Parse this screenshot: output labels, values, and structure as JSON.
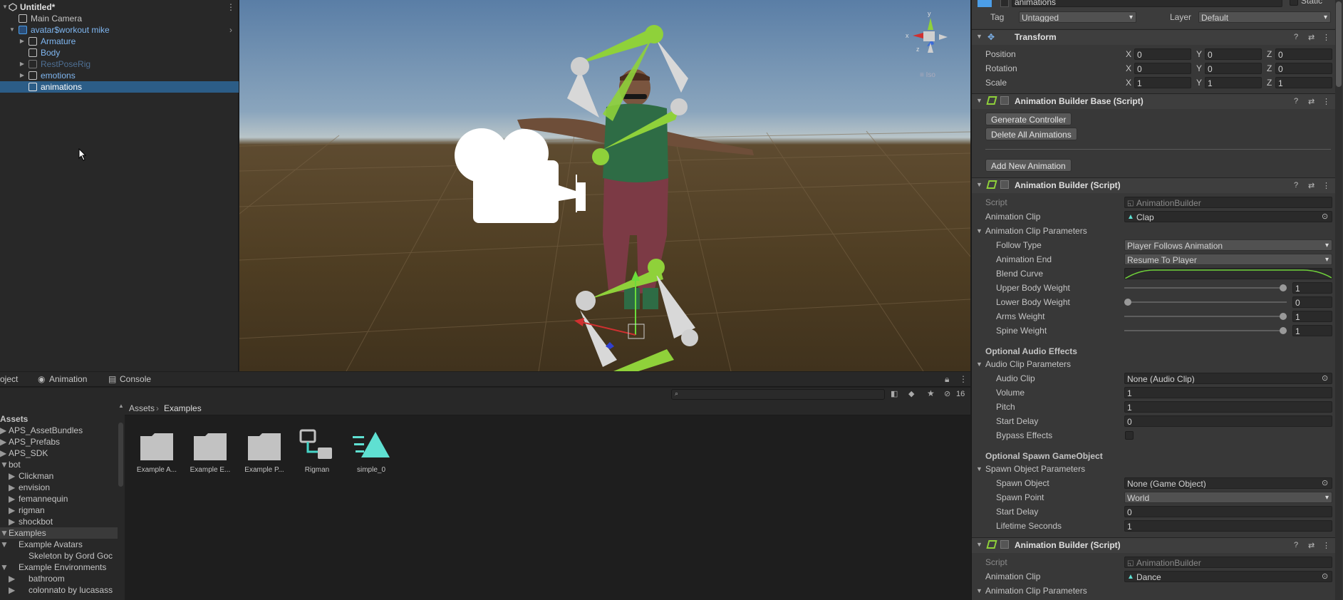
{
  "hierarchy": {
    "scene_name": "Untitled*",
    "items": [
      {
        "label": "Main Camera"
      },
      {
        "label": "avatar$workout mike"
      },
      {
        "label": "Armature"
      },
      {
        "label": "Body"
      },
      {
        "label": "RestPoseRig"
      },
      {
        "label": "emotions"
      },
      {
        "label": "animations"
      }
    ]
  },
  "bottom_tabs": {
    "project": "oject",
    "animation": "Animation",
    "console": "Console",
    "hidden_count": "16"
  },
  "project": {
    "breadcrumb": [
      "Assets",
      "Examples"
    ],
    "tree": [
      {
        "label": "Assets"
      },
      {
        "label": "APS_AssetBundles"
      },
      {
        "label": "APS_Prefabs"
      },
      {
        "label": "APS_SDK"
      },
      {
        "label": "bot"
      },
      {
        "label": "Clickman"
      },
      {
        "label": "envision"
      },
      {
        "label": "femannequin"
      },
      {
        "label": "rigman"
      },
      {
        "label": "shockbot"
      },
      {
        "label": "Examples"
      },
      {
        "label": "Example Avatars"
      },
      {
        "label": "Skeleton by Gord Goc"
      },
      {
        "label": "Example Environments"
      },
      {
        "label": "bathroom"
      },
      {
        "label": "colonnato by lucasass"
      }
    ],
    "assets": [
      {
        "label": "Example A..."
      },
      {
        "label": "Example E..."
      },
      {
        "label": "Example P..."
      },
      {
        "label": "Rigman"
      },
      {
        "label": "simple_0"
      }
    ]
  },
  "inspector": {
    "object_name": "animations",
    "static_label": "Static",
    "tag_label": "Tag",
    "tag_value": "Untagged",
    "layer_label": "Layer",
    "layer_value": "Default",
    "transform": {
      "title": "Transform",
      "position_label": "Position",
      "rotation_label": "Rotation",
      "scale_label": "Scale",
      "x": "X",
      "y": "Y",
      "z": "Z",
      "position": [
        "0",
        "0",
        "0"
      ],
      "rotation": [
        "0",
        "0",
        "0"
      ],
      "scale": [
        "1",
        "1",
        "1"
      ]
    },
    "base": {
      "title": "Animation Builder Base (Script)",
      "generate": "Generate Controller",
      "delete": "Delete All Animations",
      "add": "Add New Animation"
    },
    "builder1": {
      "title": "Animation Builder (Script)",
      "script_label": "Script",
      "script_value": "AnimationBuilder",
      "clip_label": "Animation Clip",
      "clip_value": "Clap",
      "params_label": "Animation Clip Parameters",
      "follow_label": "Follow Type",
      "follow_value": "Player Follows Animation",
      "end_label": "Animation End",
      "end_value": "Resume To Player",
      "blend_label": "Blend Curve",
      "upper_label": "Upper Body Weight",
      "upper_value": "1",
      "lower_label": "Lower Body Weight",
      "lower_value": "0",
      "arms_label": "Arms Weight",
      "arms_value": "1",
      "spine_label": "Spine Weight",
      "spine_value": "1",
      "audio_section": "Optional Audio Effects",
      "audio_params": "Audio Clip Parameters",
      "audio_clip_label": "Audio Clip",
      "audio_clip_value": "None (Audio Clip)",
      "volume_label": "Volume",
      "volume_value": "1",
      "pitch_label": "Pitch",
      "pitch_value": "1",
      "start_delay_label": "Start Delay",
      "start_delay_value": "0",
      "bypass_label": "Bypass Effects",
      "spawn_section": "Optional Spawn GameObject",
      "spawn_params": "Spawn Object Parameters",
      "spawn_obj_label": "Spawn Object",
      "spawn_obj_value": "None (Game Object)",
      "spawn_point_label": "Spawn Point",
      "spawn_point_value": "World",
      "spawn_delay_label": "Start Delay",
      "spawn_delay_value": "0",
      "lifetime_label": "Lifetime Seconds",
      "lifetime_value": "1"
    },
    "builder2": {
      "title": "Animation Builder (Script)",
      "script_label": "Script",
      "script_value": "AnimationBuilder",
      "clip_label": "Animation Clip",
      "clip_value": "Dance",
      "params_label": "Animation Clip Parameters"
    }
  },
  "weights": {
    "upper": 1,
    "lower": 0,
    "arms": 1,
    "spine": 1
  },
  "colors": {
    "selection": "#2c5d87",
    "prefab_blue": "#4c9ee8",
    "bone_green": "#8fd13a",
    "panel": "#383838"
  }
}
